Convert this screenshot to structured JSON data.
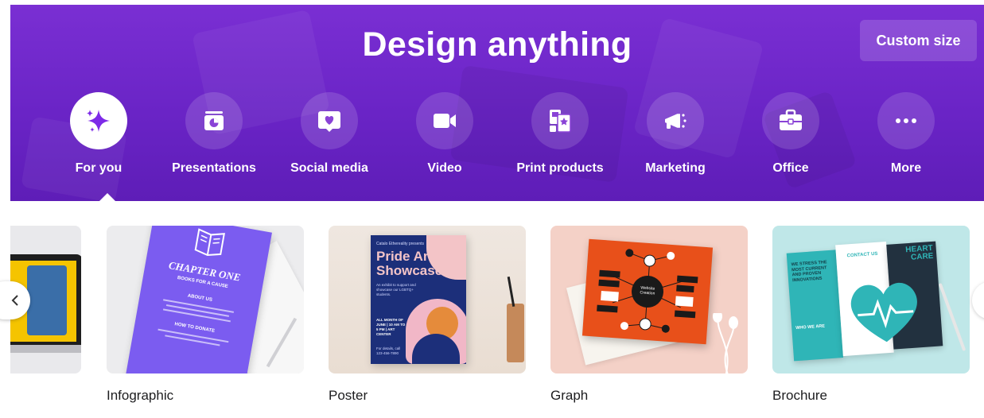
{
  "hero": {
    "title": "Design anything",
    "custom_size_label": "Custom size",
    "categories": [
      {
        "label": "For you",
        "icon": "sparkle-icon",
        "active": true
      },
      {
        "label": "Presentations",
        "icon": "presentation-icon"
      },
      {
        "label": "Social media",
        "icon": "heart-chat-icon"
      },
      {
        "label": "Video",
        "icon": "video-camera-icon"
      },
      {
        "label": "Print products",
        "icon": "print-products-icon"
      },
      {
        "label": "Marketing",
        "icon": "megaphone-icon"
      },
      {
        "label": "Office",
        "icon": "briefcase-icon"
      },
      {
        "label": "More",
        "icon": "more-dots-icon"
      }
    ]
  },
  "cards": [
    {
      "label": "Infographic"
    },
    {
      "label": "Poster"
    },
    {
      "label": "Graph"
    },
    {
      "label": "Brochure"
    }
  ],
  "thumbs": {
    "infographic": {
      "heading": "CHAPTER ONE",
      "subheading": "BOOKS FOR A CAUSE",
      "about": "ABOUT US",
      "donate": "HOW TO DONATE"
    },
    "poster": {
      "kicker": "Catalo Ethereality presents",
      "title_line1": "Pride Art",
      "title_line2": "Showcase",
      "blurb": "An exhibit to support and showcase our LGBTQ+ students.",
      "dates": "ALL MONTH OF JUNE | 10 AM TO 5 PM | ART CENTER",
      "contact": "For details, call 123-456-7890"
    },
    "graph": {
      "center_label": "Website Creation"
    },
    "brochure": {
      "left_heading": "WE STRESS THE MOST CURRENT AND PROVEN INNOVATIONS",
      "mid_heading": "CONTACT US",
      "right_heading": "HEART CARE",
      "who": "WHO WE ARE"
    }
  },
  "colors": {
    "hero_purple": "#6a24c6",
    "infographic_purple": "#7b5cf0",
    "poster_navy": "#1c2f7a",
    "graph_orange": "#e8501a",
    "brochure_teal": "#2fb5b7"
  }
}
